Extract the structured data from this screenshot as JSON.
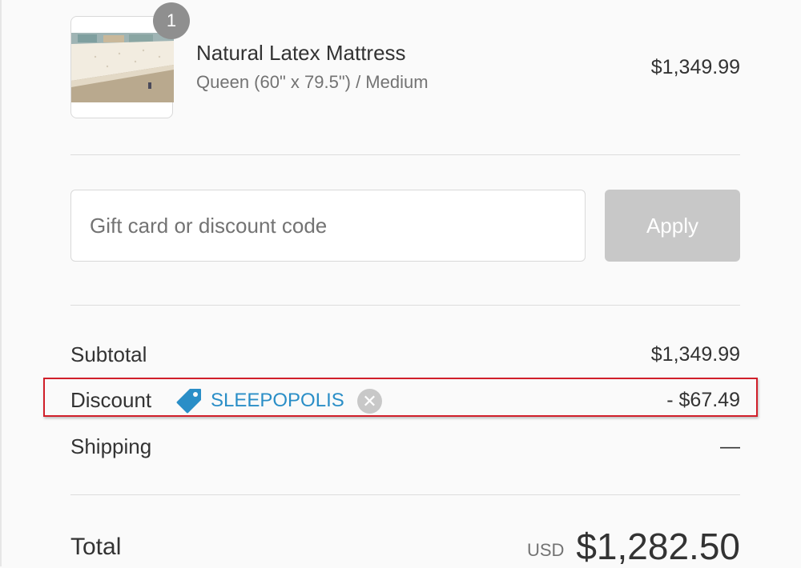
{
  "cart": {
    "items": [
      {
        "quantity": "1",
        "name": "Natural Latex Mattress",
        "variant": "Queen (60\" x 79.5\") / Medium",
        "price": "$1,349.99"
      }
    ]
  },
  "discount_form": {
    "placeholder": "Gift card or discount code",
    "apply_label": "Apply"
  },
  "summary": {
    "subtotal_label": "Subtotal",
    "subtotal_value": "$1,349.99",
    "discount_label": "Discount",
    "discount_code": "SLEEPOPOLIS",
    "discount_value": "- $67.49",
    "shipping_label": "Shipping",
    "shipping_value": "—",
    "total_label": "Total",
    "currency": "USD",
    "total_value": "$1,282.50"
  },
  "icons": {
    "tag": "tag-icon",
    "remove": "close-circle-icon"
  },
  "colors": {
    "accent": "#2a8ec7",
    "highlight_border": "#d11f2a",
    "disabled_button": "#c8c8c8"
  }
}
